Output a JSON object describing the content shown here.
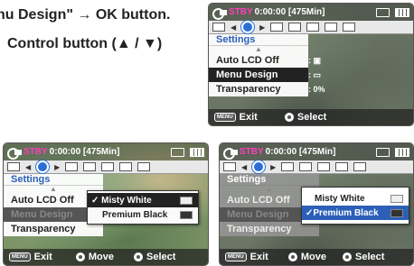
{
  "instructions": {
    "line1": "nu Design\" → OK button.",
    "line2": "Control button (▲ / ▼)"
  },
  "status": {
    "mode": "STBY",
    "time": "0:00:00 [475Min]"
  },
  "menu": {
    "title": "Settings",
    "items": [
      "Auto LCD Off",
      "Menu Design",
      "Transparency"
    ],
    "values": {
      "transparency": "0%"
    }
  },
  "bottom_a": {
    "exit": "Exit",
    "select": "Select"
  },
  "bottom_b": {
    "exit": "Exit",
    "move": "Move",
    "select": "Select"
  },
  "popup_options": [
    "Misty White",
    "Premium Black"
  ],
  "keys": {
    "menu": "MENU"
  },
  "colors": {
    "accent": "#2b5fb8",
    "stby": "#ff3fc0"
  }
}
